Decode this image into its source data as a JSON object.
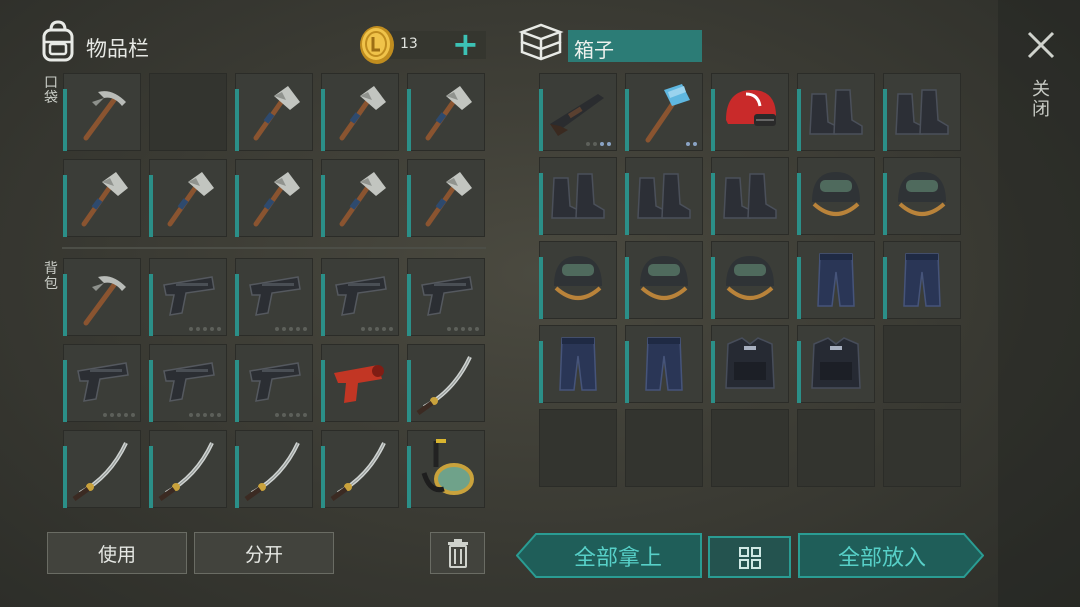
{
  "inventory": {
    "title": "物品栏",
    "coins": "13",
    "plus": "+",
    "pocket_label": "口袋",
    "backpack_label": "背包",
    "use_button": "使用",
    "split_button": "分开"
  },
  "box": {
    "title": "箱子",
    "take_all": "全部拿上",
    "put_all": "全部放入"
  },
  "close_label": "关闭",
  "colors": {
    "accent": "#2a9c93",
    "accent_text": "#57d0c8",
    "durability": "#2b8f88"
  },
  "inventory_items": {
    "pocket": [
      "pickaxe",
      "",
      "hatchet",
      "hatchet",
      "hatchet",
      "hatchet",
      "hatchet",
      "hatchet",
      "hatchet",
      "hatchet"
    ],
    "backpack": [
      "pickaxe",
      "pistol",
      "pistol",
      "pistol",
      "pistol",
      "pistol",
      "pistol",
      "pistol",
      "flare-gun",
      "katana",
      "katana",
      "katana",
      "katana",
      "katana",
      "diving-goggles"
    ]
  },
  "box_items": [
    "shotgun",
    "sledgehammer",
    "red-helmet",
    "boots",
    "boots",
    "boots",
    "boots",
    "boots",
    "military-helmet",
    "military-helmet",
    "military-helmet",
    "military-helmet",
    "military-helmet",
    "police-pants",
    "police-pants",
    "police-pants",
    "police-pants",
    "police-vest",
    "police-vest",
    "",
    "",
    "",
    "",
    "",
    ""
  ]
}
